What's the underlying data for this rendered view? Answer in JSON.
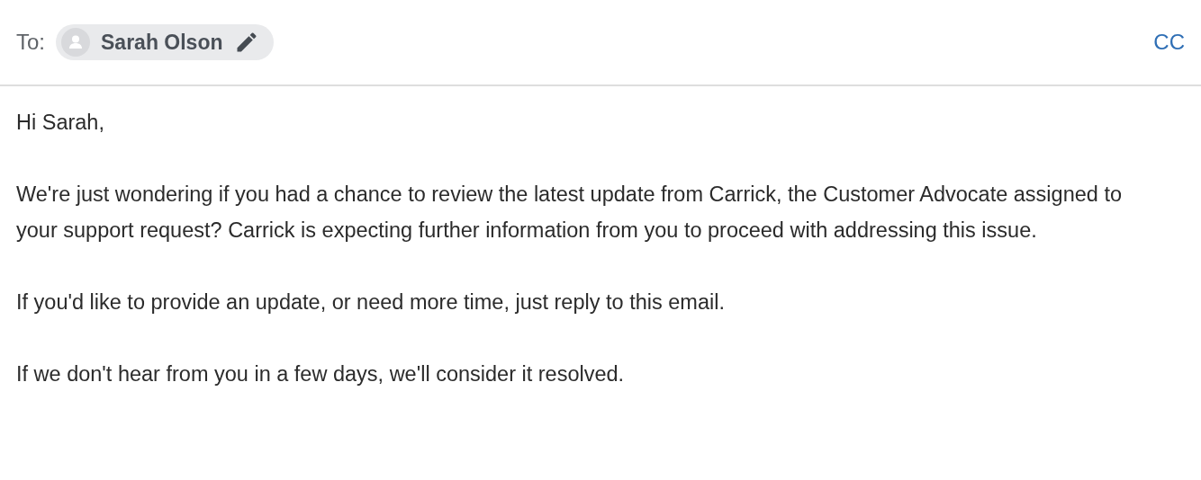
{
  "header": {
    "to_label": "To:",
    "recipient": {
      "name": "Sarah Olson"
    },
    "cc": "CC"
  },
  "body": [
    "Hi Sarah,",
    "We're just wondering if you had a chance to review the latest update from Carrick, the Customer Advocate assigned to your support request? Carrick is expecting further information from you to proceed with addressing this issue.",
    "If you'd like to provide an update, or need more time, just reply to this email.",
    "If we don't hear from you in a few days, we'll consider it resolved."
  ]
}
